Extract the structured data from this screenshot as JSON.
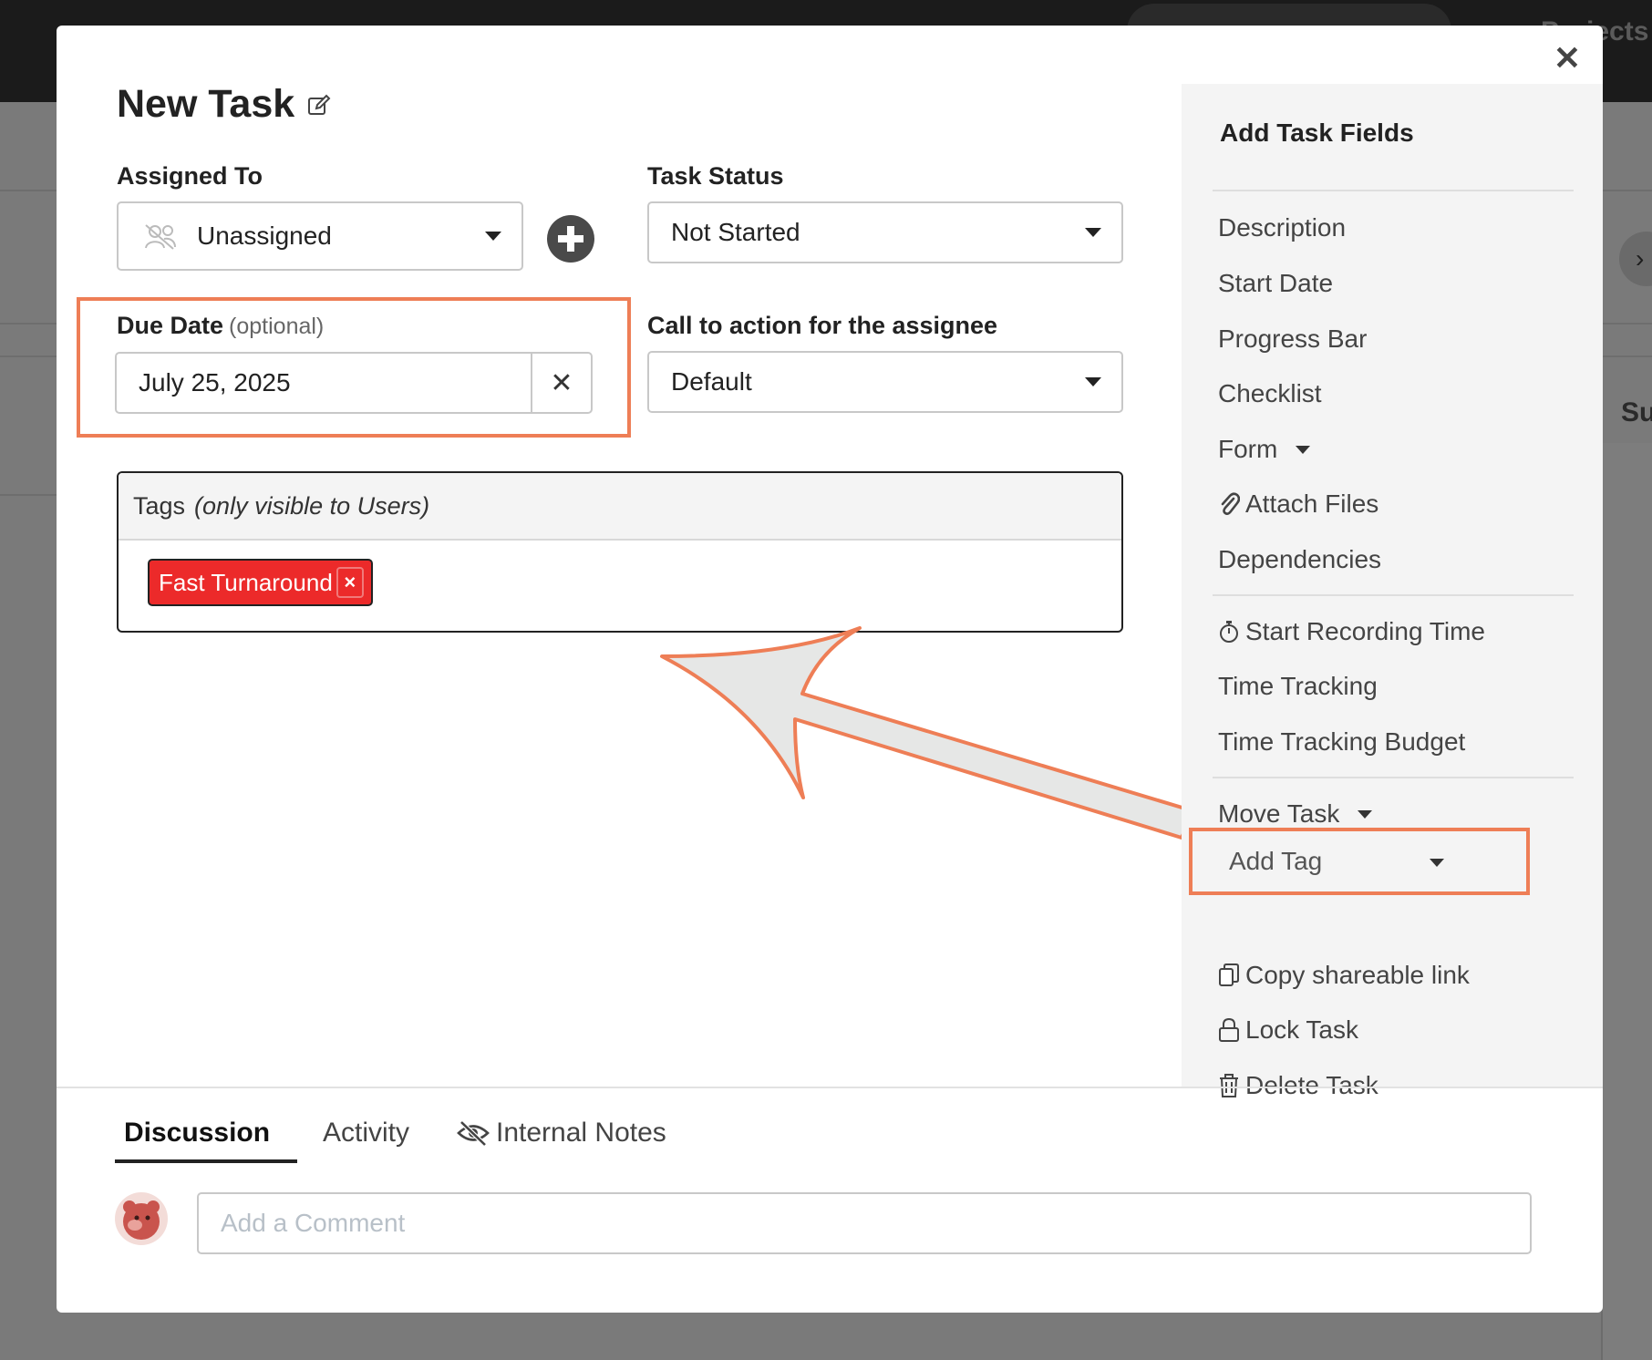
{
  "background": {
    "projects_label": "Projects",
    "side_heading": "Su",
    "chevron": "›"
  },
  "modal": {
    "title": "New Task",
    "close_symbol": "✕",
    "assigned_to": {
      "label": "Assigned To",
      "value": "Unassigned"
    },
    "task_status": {
      "label": "Task Status",
      "value": "Not Started"
    },
    "due_date": {
      "label": "Due Date",
      "optional": "(optional)",
      "value": "July 25, 2025",
      "clear_symbol": "✕"
    },
    "cta": {
      "label": "Call to action for the assignee",
      "value": "Default"
    },
    "tags": {
      "label": "Tags",
      "note": "(only visible to Users)",
      "items": [
        {
          "label": "Fast Turnaround",
          "remove_symbol": "×"
        }
      ]
    }
  },
  "sidebar": {
    "title": "Add Task Fields",
    "items": [
      {
        "label": "Description"
      },
      {
        "label": "Start Date"
      },
      {
        "label": "Progress Bar"
      },
      {
        "label": "Checklist"
      },
      {
        "label": "Form"
      },
      {
        "label": "Attach Files",
        "icon": "paperclip-icon"
      },
      {
        "label": "Dependencies"
      },
      {
        "label": "Start Recording Time",
        "icon": "stopwatch-icon"
      },
      {
        "label": "Time Tracking"
      },
      {
        "label": "Time Tracking Budget"
      },
      {
        "label": "Move Task"
      },
      {
        "label": "Add Tag"
      },
      {
        "label": "Copy shareable link",
        "icon": "copy-icon"
      },
      {
        "label": "Lock Task",
        "icon": "lock-icon"
      },
      {
        "label": "Delete Task",
        "icon": "trash-icon"
      }
    ]
  },
  "footer": {
    "tabs": [
      {
        "label": "Discussion",
        "active": true
      },
      {
        "label": "Activity",
        "active": false
      },
      {
        "label": "Internal Notes",
        "active": false,
        "icon": "eye-slash-icon"
      }
    ],
    "comment_placeholder": "Add a Comment"
  },
  "colors": {
    "highlight": "#ee7e56",
    "tag_red": "#ec2a2a",
    "sidebar_bg": "#f4f4f4",
    "arrow_fill": "#e6e7e6"
  }
}
